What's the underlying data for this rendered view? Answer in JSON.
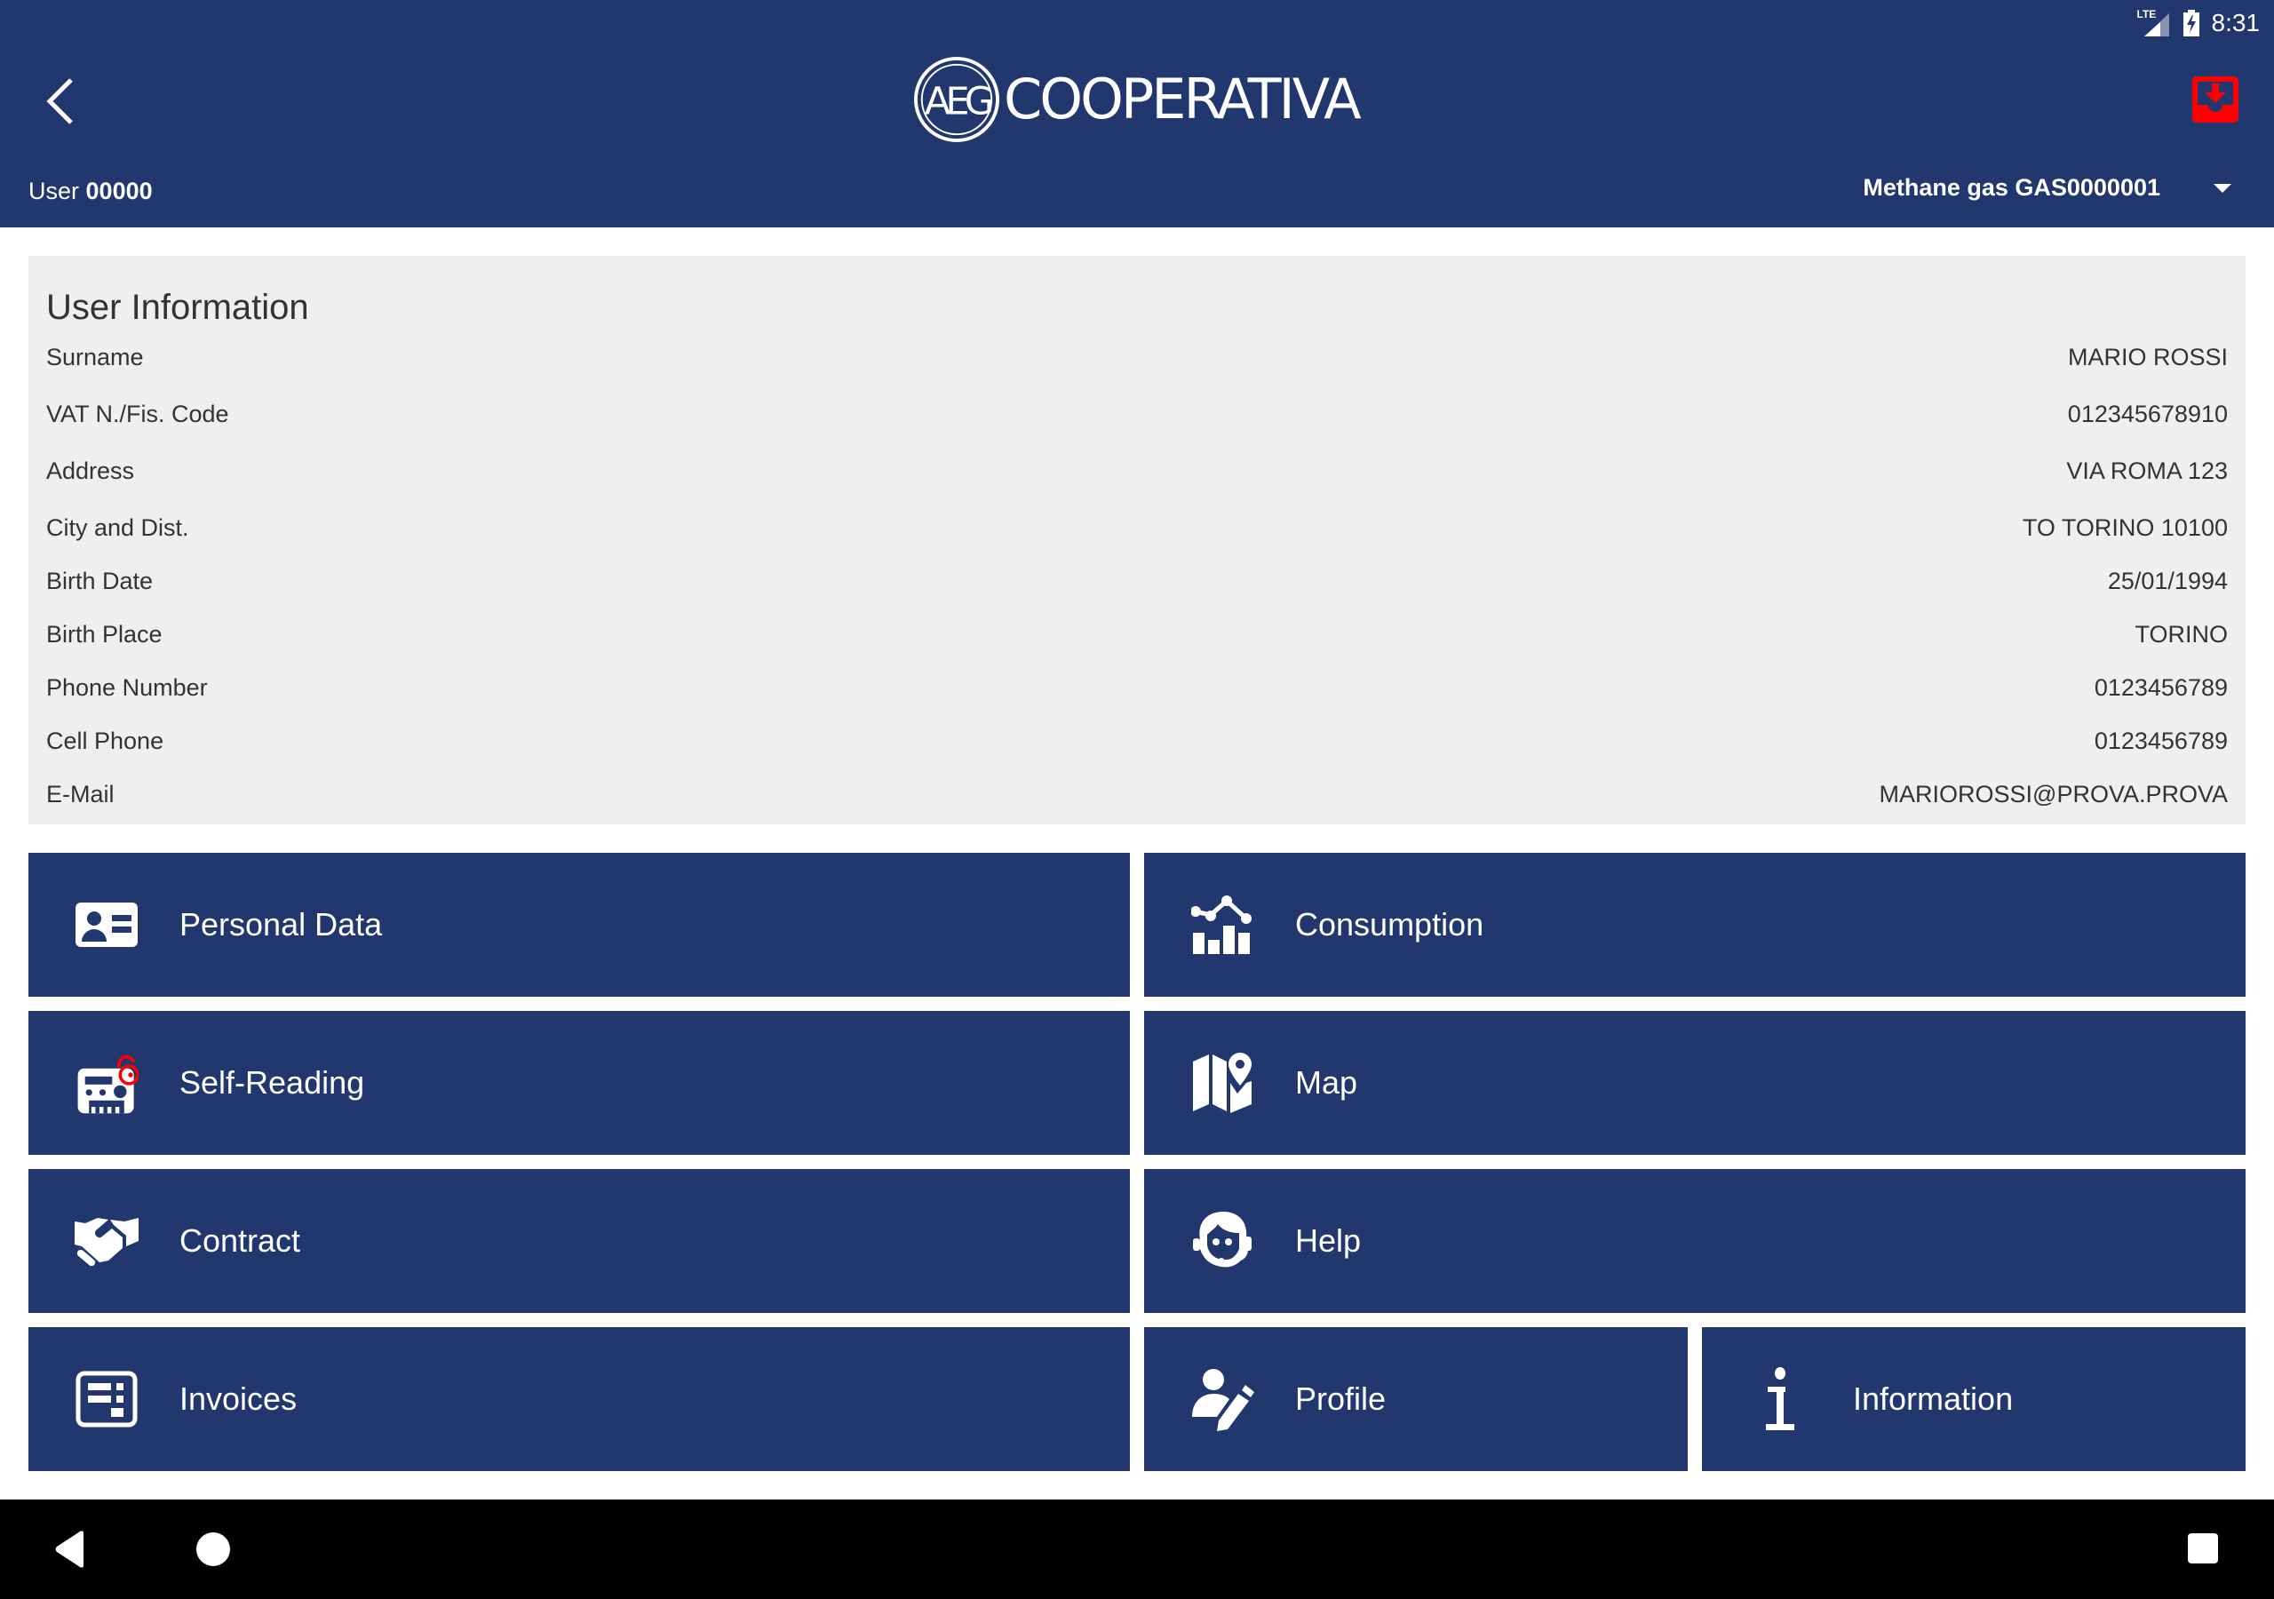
{
  "status_bar": {
    "network": "LTE",
    "time": "8:31"
  },
  "header": {
    "logo_monogram": "AEG",
    "logo_text": "COOPERATIVA",
    "user_label": "User",
    "user_id": "00000",
    "supply_selected": "Methane gas GAS0000001",
    "colors": {
      "primary": "#22376e",
      "accent_red": "#ff0000"
    }
  },
  "user_info": {
    "title": "User Information",
    "rows": [
      {
        "label": "Surname",
        "value": "MARIO ROSSI"
      },
      {
        "label": "VAT N./Fis. Code",
        "value": "012345678910"
      },
      {
        "label": "Address",
        "value": "VIA ROMA 123"
      },
      {
        "label": "City and Dist.",
        "value": "TO TORINO 10100"
      },
      {
        "label": "Birth Date",
        "value": "25/01/1994"
      },
      {
        "label": "Birth Place",
        "value": "TORINO"
      },
      {
        "label": "Phone Number",
        "value": "0123456789"
      },
      {
        "label": "Cell Phone",
        "value": "0123456789"
      },
      {
        "label": "E-Mail",
        "value": "MARIOROSSI@PROVA.PROVA"
      }
    ]
  },
  "menu": {
    "personal_data": {
      "label": "Personal Data",
      "icon": "id-card-icon"
    },
    "consumption": {
      "label": "Consumption",
      "icon": "chart-icon"
    },
    "self_reading": {
      "label": "Self-Reading",
      "icon": "meter-icon"
    },
    "map": {
      "label": "Map",
      "icon": "map-pin-icon"
    },
    "contract": {
      "label": "Contract",
      "icon": "handshake-icon"
    },
    "help": {
      "label": "Help",
      "icon": "headset-icon"
    },
    "invoices": {
      "label": "Invoices",
      "icon": "invoice-icon"
    },
    "profile": {
      "label": "Profile",
      "icon": "user-edit-icon"
    },
    "information": {
      "label": "Information",
      "icon": "info-icon"
    }
  }
}
